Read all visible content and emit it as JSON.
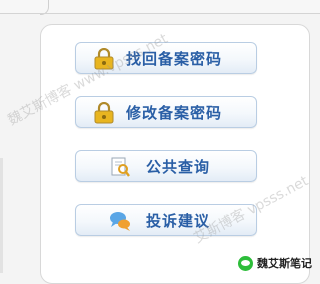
{
  "buttons": [
    {
      "label": "找回备案密码",
      "icon": "lock-icon"
    },
    {
      "label": "修改备案密码",
      "icon": "lock-icon"
    },
    {
      "label": "公共查询",
      "icon": "document-search-icon"
    },
    {
      "label": "投诉建议",
      "icon": "chat-bubbles-icon"
    }
  ],
  "watermarks": {
    "w1": "魏艾斯博客 www.vpsss.net",
    "w2": "艾斯博客 vpsss.net"
  },
  "brand": {
    "name": "魏艾斯笔记"
  },
  "colors": {
    "label": "#2a5fa6",
    "button_border": "#b9cde3",
    "lock": "#e8b520",
    "bubble_blue": "#5aa6e6",
    "bubble_orange": "#f0a030"
  }
}
